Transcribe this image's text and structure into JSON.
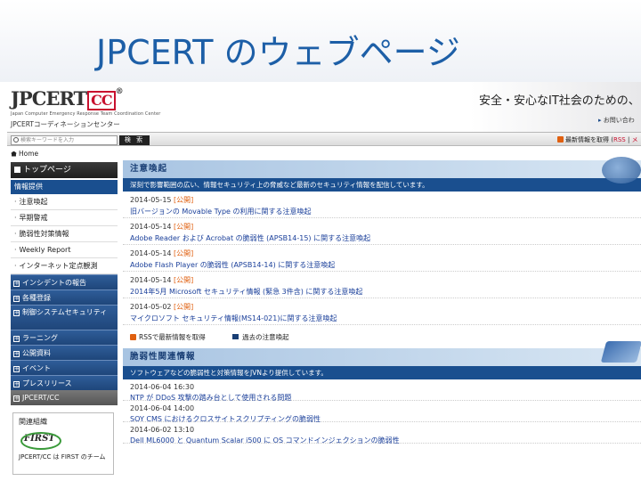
{
  "slide": {
    "title": "JPCERT のウェブページ"
  },
  "header": {
    "logo_main": "JPCERT",
    "logo_cc": "CC",
    "logo_reg": "®",
    "logo_sub": "Japan Computer Emergency Response Team Coordination Center",
    "logo_jp": "JPCERTコーディネーションセンター",
    "tagline": "安全・安心なIT社会のための、",
    "inquiry": "お問い合わ"
  },
  "search": {
    "placeholder": "検索キーワードを入力",
    "button": "検 索",
    "rss_label": "最新情報を取得",
    "rss_link": "RSS",
    "sep": "|",
    "extra": "メ"
  },
  "breadcrumb": {
    "home": "Home"
  },
  "sidebar": {
    "top_page": "トップページ",
    "section": "情報提供",
    "sub_items": [
      "注意喚起",
      "早期警戒",
      "脆弱性対策情報",
      "Weekly Report",
      "インターネット定点観測"
    ],
    "categories": [
      "インシデントの報告",
      "各種登録",
      "制御システムセキュリティ",
      "ラーニング",
      "公開資料",
      "イベント",
      "プレスリリース"
    ],
    "jpcert_cc": "JPCERT/CC",
    "related_title": "関連組織",
    "first_logo": "FIRST",
    "related_text": "JPCERT/CC は FIRST のチーム"
  },
  "alerts": {
    "heading": "注意喚起",
    "description": "深刻で影響範囲の広い、情報セキュリティ上の脅威など最新のセキュリティ情報を配信しています。",
    "items": [
      {
        "date": "2014-05-15",
        "tag": "[公開]",
        "title": "旧バージョンの Movable Type の利用に関する注意喚起"
      },
      {
        "date": "2014-05-14",
        "tag": "[公開]",
        "title": "Adobe Reader および Acrobat の脆弱性 (APSB14-15) に関する注意喚起"
      },
      {
        "date": "2014-05-14",
        "tag": "[公開]",
        "title": "Adobe Flash Player の脆弱性 (APSB14-14) に関する注意喚起"
      },
      {
        "date": "2014-05-14",
        "tag": "[公開]",
        "title": "2014年5月 Microsoft セキュリティ情報 (緊急 3件含) に関する注意喚起"
      },
      {
        "date": "2014-05-02",
        "tag": "[公開]",
        "title": "マイクロソフト セキュリティ情報(MS14-021)に関する注意喚起"
      }
    ],
    "rss_link": "RSSで最新情報を取得",
    "past_link": "過去の注意喚起"
  },
  "vulns": {
    "heading": "脆弱性関連情報",
    "description": "ソフトウェアなどの脆弱性と対策情報をJVNより提供しています。",
    "items": [
      {
        "date": "2014-06-04 16:30",
        "title": "NTP が DDoS 攻撃の踏み台として使用される問題"
      },
      {
        "date": "2014-06-04 14:00",
        "title": "SOY CMS におけるクロスサイトスクリプティングの脆弱性"
      },
      {
        "date": "2014-06-02 13:10",
        "title": "Dell ML6000 と Quantum Scalar i500 に OS コマンドインジェクションの脆弱性"
      }
    ]
  }
}
